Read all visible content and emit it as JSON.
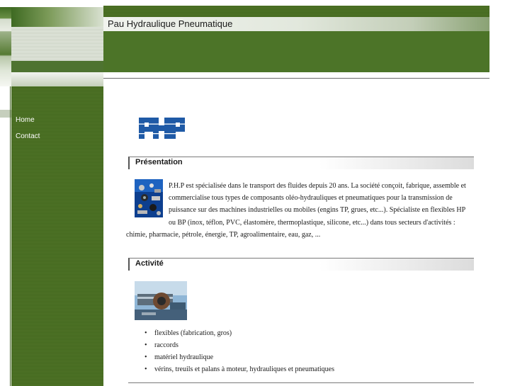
{
  "site": {
    "title": "Pau Hydraulique Pneumatique"
  },
  "nav": {
    "items": [
      "Home",
      "Contact"
    ]
  },
  "logo": {
    "text": "PHP"
  },
  "sections": {
    "presentation": {
      "title": "Présentation",
      "text": "P.H.P est spécialisée dans le transport des fluides depuis 20 ans. La société conçoit, fabrique, assemble et commercialise tous types de composants oléo-hydrauliques et pneumatiques pour la transmission de puissance sur des machines industrielles ou mobiles (engins TP, grues, etc...). Spécialiste en flexibles HP ou BP (inox, téflon, PVC, élastomère, thermoplastique, silicone, etc...) dans tous secteurs d'activités : chimie, pharmacie, pétrole, énergie, TP, agroalimentaire, eau, gaz, ..."
    },
    "activite": {
      "title": "Activité",
      "items": [
        "flexibles (fabrication, gros)",
        "raccords",
        "matériel hydraulique",
        "vérins, treuils et palans à moteur, hydrauliques et pneumatiques"
      ]
    }
  },
  "colors": {
    "header_green": "#4c7428",
    "sidebar_green": "#4f7527",
    "logo_blue": "#1f5aa6"
  },
  "icons": {
    "presentation_image": "hydraulic-components-photo",
    "activite_image": "hydraulic-cylinder-photo"
  }
}
